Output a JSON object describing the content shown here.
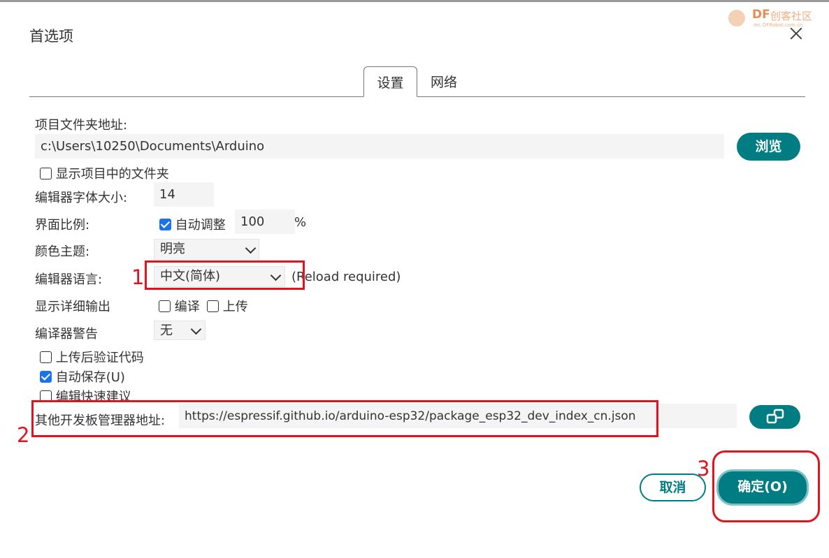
{
  "dialog": {
    "title": "首选项",
    "close_icon": "close-icon"
  },
  "watermark": {
    "brand": "DF",
    "name": "创客社区",
    "sub": "mc.DFRobot.com.cn"
  },
  "tabs": [
    {
      "label": "设置",
      "active": true
    },
    {
      "label": "网络",
      "active": false
    }
  ],
  "settings": {
    "sketchbook": {
      "label": "项目文件夹地址:",
      "value": "c:\\Users\\10250\\Documents\\Arduino",
      "browse_label": "浏览"
    },
    "show_files": {
      "label": "显示项目中的文件夹",
      "checked": false
    },
    "font_size": {
      "label": "编辑器字体大小:",
      "value": "14"
    },
    "scale": {
      "label": "界面比例:",
      "auto_label": "自动调整",
      "auto_checked": true,
      "value": "100",
      "unit": "%"
    },
    "theme": {
      "label": "颜色主题:",
      "value": "明亮"
    },
    "language": {
      "label": "编辑器语言:",
      "value": "中文(简体)",
      "note": "(Reload required)"
    },
    "verbose": {
      "label": "显示详细输出",
      "compile_label": "编译",
      "compile_checked": false,
      "upload_label": "上传",
      "upload_checked": false
    },
    "warnings": {
      "label": "编译器警告",
      "value": "无"
    },
    "verify_after_upload": {
      "label": "上传后验证代码",
      "checked": false
    },
    "autosave": {
      "label": "自动保存(U)",
      "checked": true
    },
    "quick_suggest": {
      "label": "编辑快速建议",
      "checked": false
    },
    "board_urls": {
      "label": "其他开发板管理器地址:",
      "value": "https://espressif.github.io/arduino-esp32/package_esp32_dev_index_cn.json",
      "edit_icon": "open-window-icon"
    }
  },
  "footer": {
    "cancel_label": "取消",
    "ok_label": "确定(O)"
  },
  "annotations": {
    "num1": "1",
    "num2": "2",
    "num3": "3",
    "color": "#e0131e"
  },
  "colors": {
    "accent": "#007d82",
    "checkbox": "#1a73e8"
  }
}
